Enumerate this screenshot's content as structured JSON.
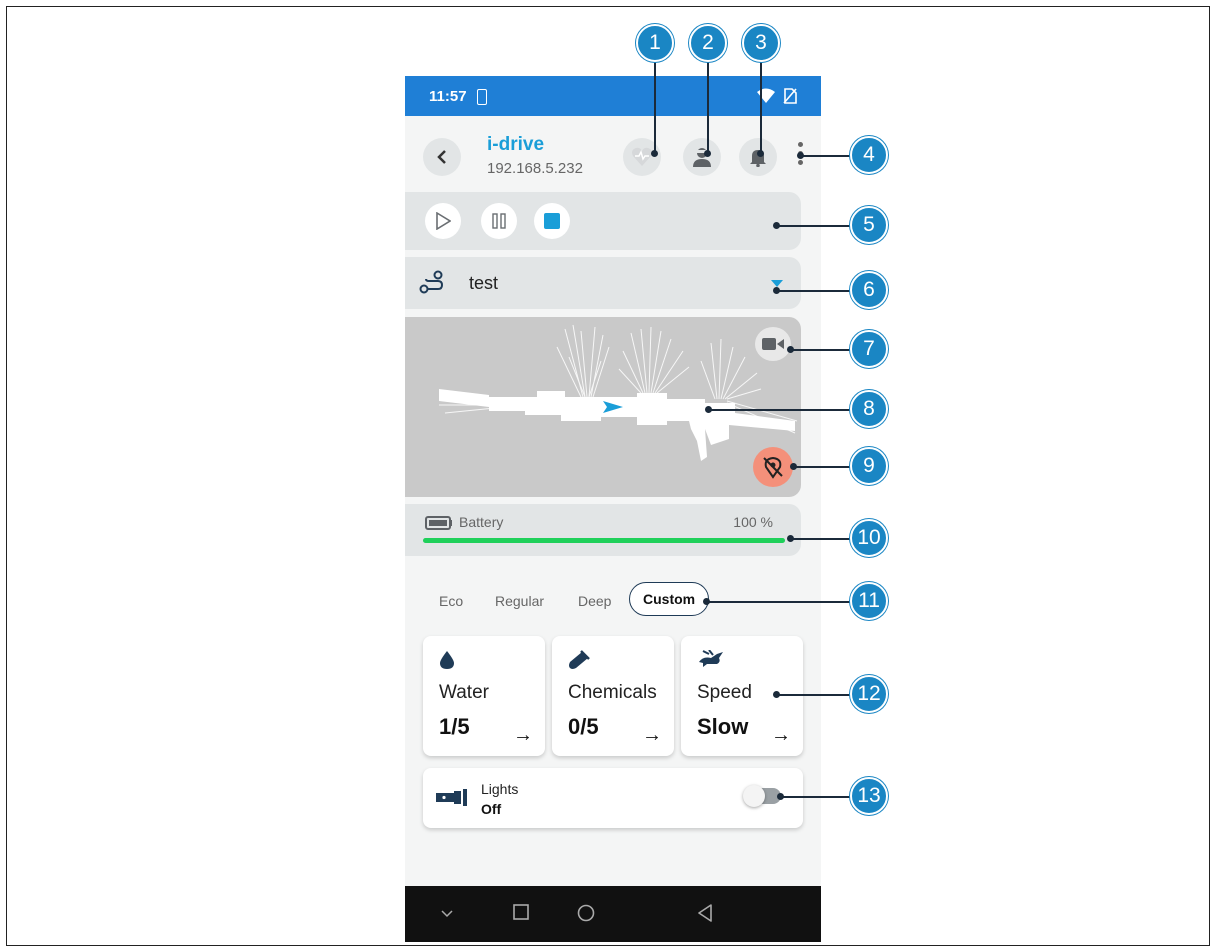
{
  "status_bar": {
    "time": "11:57"
  },
  "header": {
    "title": "i-drive",
    "ip": "192.168.5.232"
  },
  "route": {
    "name": "test"
  },
  "battery": {
    "label": "Battery",
    "value_text": "100 %",
    "level": 1.0,
    "fill_color": "#1fd05a"
  },
  "modes": [
    {
      "label": "Eco",
      "active": false
    },
    {
      "label": "Regular",
      "active": false
    },
    {
      "label": "Deep",
      "active": false
    },
    {
      "label": "Custom",
      "active": true
    }
  ],
  "tiles": [
    {
      "icon": "water-drop-icon",
      "label": "Water",
      "value": "1/5",
      "arrow": "→"
    },
    {
      "icon": "chemicals-icon",
      "label": "Chemicals",
      "value": "0/5",
      "arrow": "→"
    },
    {
      "icon": "rabbit-speed-icon",
      "label": "Speed",
      "value": "Slow",
      "arrow": "→"
    }
  ],
  "lights": {
    "label": "Lights",
    "value": "Off",
    "on": false
  },
  "callouts": [
    "1",
    "2",
    "3",
    "4",
    "5",
    "6",
    "7",
    "8",
    "9",
    "10",
    "11",
    "12",
    "13"
  ],
  "colors": {
    "status_bar": "#1f7fd6",
    "accent": "#1a9ed8",
    "callout": "#1a86c4",
    "location_button": "#f4907a"
  }
}
